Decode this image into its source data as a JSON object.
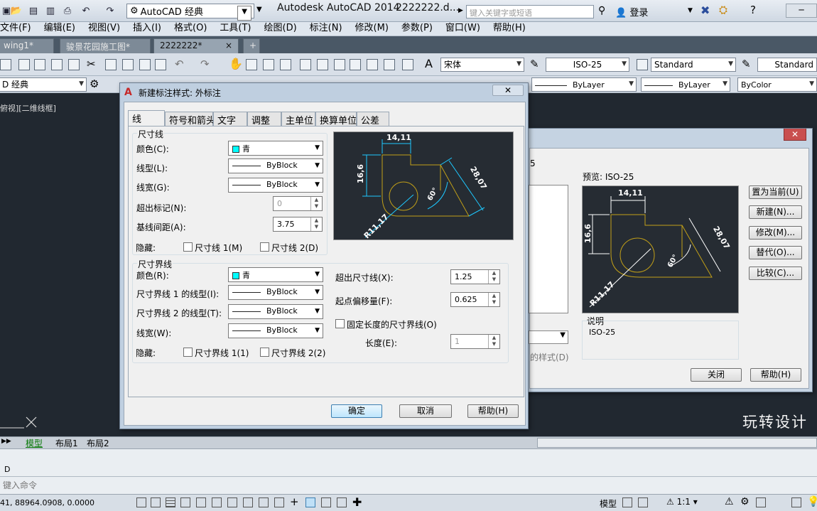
{
  "titlebar": {
    "workspace": "AutoCAD 经典",
    "app_title": "Autodesk AutoCAD 2014",
    "doc_name": "2222222.d...",
    "search_placeholder": "键入关键字或短语",
    "login": "登录"
  },
  "menu": [
    "文件(F)",
    "编辑(E)",
    "视图(V)",
    "插入(I)",
    "格式(O)",
    "工具(T)",
    "绘图(D)",
    "标注(N)",
    "修改(M)",
    "参数(P)",
    "窗口(W)",
    "帮助(H)"
  ],
  "doc_tabs": [
    "wing1*",
    "骏景花园施工图*",
    "2222222*"
  ],
  "toolbar": {
    "font": "宋体",
    "dimstyle": "ISO-25",
    "textstyle": "Standard",
    "tablestyle": "Standard",
    "workspace_short": "D 经典",
    "linetype1": "ByLayer",
    "linetype2": "ByLayer",
    "color": "ByColor"
  },
  "viewport_label": "俯视][二维线框]",
  "watermark": "玩转设计",
  "model_tabs": [
    "模型",
    "布局1",
    "布局2"
  ],
  "command": {
    "history": "D",
    "prompt": "键入命令"
  },
  "status": {
    "coords": "41, 88964.0908, 0.0000",
    "model": "模型",
    "scale": "1:1"
  },
  "back_dialog": {
    "partial_label": "5",
    "preview_label": "预览: ISO-25",
    "buttons": [
      "置为当前(U)",
      "新建(N)...",
      "修改(M)...",
      "替代(O)...",
      "比较(C)..."
    ],
    "desc_title": "说明",
    "desc_text": "ISO-25",
    "style_label": "的样式(D)",
    "close": "关闭",
    "help": "帮助(H)"
  },
  "dialog": {
    "title": "新建标注样式: 外标注",
    "tabs": [
      "线",
      "符号和箭头",
      "文字",
      "调整",
      "主单位",
      "换算单位",
      "公差"
    ],
    "dimline": {
      "group": "尺寸线",
      "color_label": "颜色(C):",
      "color_value": "青",
      "linetype_label": "线型(L):",
      "linetype_value": "ByBlock",
      "lineweight_label": "线宽(G):",
      "lineweight_value": "ByBlock",
      "extend_label": "超出标记(N):",
      "extend_value": "0",
      "baseline_label": "基线间距(A):",
      "baseline_value": "3.75",
      "suppress_label": "隐藏:",
      "suppress1": "尺寸线 1(M)",
      "suppress2": "尺寸线 2(D)"
    },
    "extline": {
      "group": "尺寸界线",
      "color_label": "颜色(R):",
      "color_value": "青",
      "lt1_label": "尺寸界线 1 的线型(I):",
      "lt1_value": "ByBlock",
      "lt2_label": "尺寸界线 2 的线型(T):",
      "lt2_value": "ByBlock",
      "lineweight_label": "线宽(W):",
      "lineweight_value": "ByBlock",
      "suppress_label": "隐藏:",
      "suppress1": "尺寸界线 1(1)",
      "suppress2": "尺寸界线 2(2)",
      "beyond_label": "超出尺寸线(X):",
      "beyond_value": "1.25",
      "offset_label": "起点偏移量(F):",
      "offset_value": "0.625",
      "fixed_label": "固定长度的尺寸界线(O)",
      "length_label": "长度(E):",
      "length_value": "1"
    },
    "preview": {
      "d1": "14,11",
      "d2": "16,6",
      "d3": "28,07",
      "d4": "R11,17",
      "d5": "60°"
    },
    "ok": "确定",
    "cancel": "取消",
    "help": "帮助(H)"
  }
}
